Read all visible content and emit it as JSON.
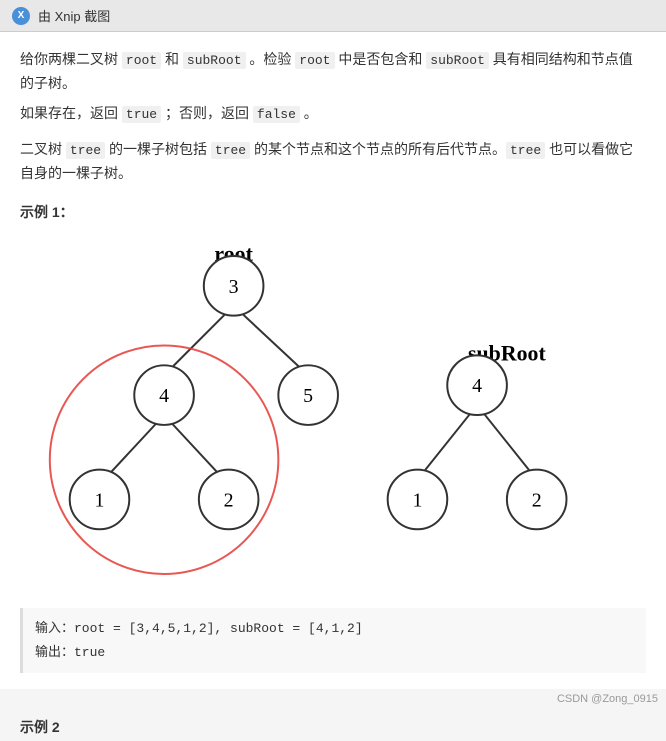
{
  "titleBar": {
    "logo": "X",
    "title": "由 Xnip 截图"
  },
  "problemDesc": {
    "line1": "给你两棵二叉树 root 和 subRoot 。检验 root 中是否包含和 subRoot 具有相同结构和节点值的子树。",
    "line2": "如果存在，返回 true ；否则，返回 false 。",
    "line3": "二叉树 tree 的一棵子树包括 tree 的某个节点和这个节点的所有后代节点。tree 也可以看做它自身的一棵子树。"
  },
  "example1": {
    "label": "示例 1：",
    "rootLabel": "root",
    "subRootLabel": "subRoot",
    "input": "输入：root = [3,4,5,1,2], subRoot = [4,1,2]",
    "output": "输出：true"
  },
  "footer": {
    "credit": "CSDN @Zong_0915"
  },
  "example2Label": "示例 2"
}
